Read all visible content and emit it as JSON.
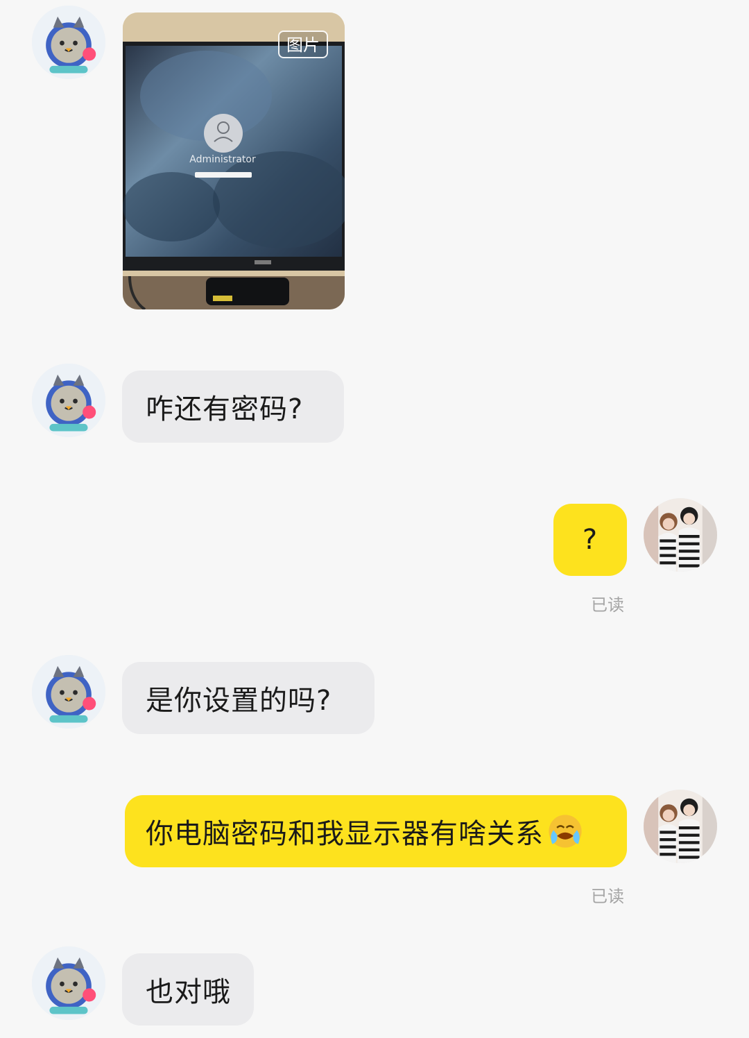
{
  "image_message": {
    "tag_label": "图片",
    "login_name": "Administrator"
  },
  "messages": [
    {
      "side": "left",
      "text": "咋还有密码?"
    },
    {
      "side": "right",
      "text": "?",
      "status": "已读"
    },
    {
      "side": "left",
      "text": "是你设置的吗?"
    },
    {
      "side": "right",
      "text": "你电脑密码和我显示器有啥关系",
      "emoji": "crying-emoji",
      "status": "已读"
    },
    {
      "side": "left",
      "text": "也对哦"
    }
  ],
  "colors": {
    "background": "#f7f7f7",
    "incoming_bubble": "#ebebed",
    "outgoing_bubble": "#fde21e"
  }
}
